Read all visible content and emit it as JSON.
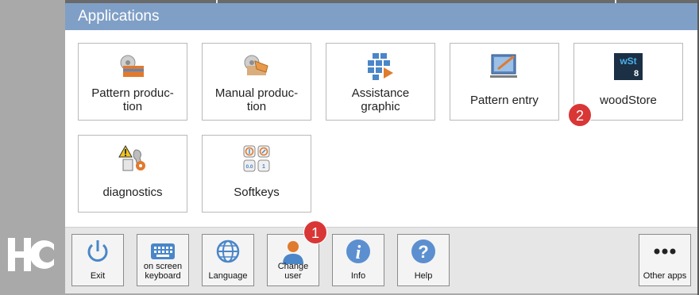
{
  "window": {
    "title": "Applications"
  },
  "badges": {
    "change_user": "1",
    "woodstore": "2"
  },
  "tiles": [
    {
      "label": "Pattern produc-\ntion",
      "icon": "pattern-production-icon"
    },
    {
      "label": "Manual produc-\ntion",
      "icon": "manual-production-icon"
    },
    {
      "label": "Assistance\ngraphic",
      "icon": "assistance-graphic-icon"
    },
    {
      "label": "Pattern entry",
      "icon": "pattern-entry-icon"
    },
    {
      "label": "woodStore",
      "icon": "woodstore-icon",
      "icon_text": "wSt",
      "icon_subtext": "8"
    },
    {
      "label": "diagnostics",
      "icon": "diagnostics-icon"
    },
    {
      "label": "Softkeys",
      "icon": "softkeys-icon",
      "icon_keys": [
        "0.0",
        "1"
      ]
    }
  ],
  "toolbar": [
    {
      "label": "Exit",
      "icon": "power-icon"
    },
    {
      "label": "on screen\nkeyboard",
      "icon": "keyboard-icon"
    },
    {
      "label": "Language",
      "icon": "globe-icon"
    },
    {
      "label": "Change\nuser",
      "icon": "user-icon"
    },
    {
      "label": "Info",
      "icon": "info-icon",
      "icon_text": "i"
    },
    {
      "label": "Help",
      "icon": "help-icon",
      "icon_text": "?"
    },
    {
      "label": "Other apps",
      "icon": "more-icon"
    }
  ],
  "colors": {
    "titlebar": "#7f9fc6",
    "accent_blue": "#4a86c8",
    "accent_orange": "#e07a2e",
    "badge": "#d93636"
  }
}
